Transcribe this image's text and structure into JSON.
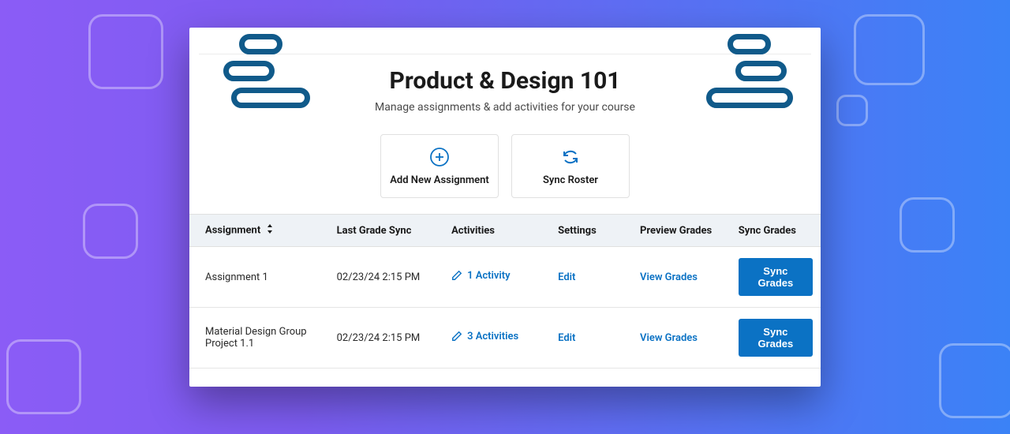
{
  "course": {
    "title": "Product & Design 101",
    "subtitle": "Manage assignments & add activities for your course"
  },
  "actions": {
    "add": "Add New Assignment",
    "sync": "Sync Roster"
  },
  "table": {
    "headers": {
      "assignment": "Assignment",
      "last_sync": "Last Grade Sync",
      "activities": "Activities",
      "settings": "Settings",
      "preview": "Preview Grades",
      "sync_grades": "Sync Grades"
    },
    "rows": [
      {
        "name": "Assignment 1",
        "last_sync": "02/23/24 2:15 PM",
        "activity_label": "1 Activity",
        "edit_label": "Edit",
        "preview_label": "View  Grades",
        "sync_label": "Sync Grades"
      },
      {
        "name": "Material Design Group Project 1.1",
        "last_sync": "02/23/24 2:15 PM",
        "activity_label": "3 Activities",
        "edit_label": "Edit",
        "preview_label": "View  Grades",
        "sync_label": "Sync Grades"
      }
    ]
  },
  "colors": {
    "primary": "#0b72c4",
    "accent": "#105a8a"
  }
}
